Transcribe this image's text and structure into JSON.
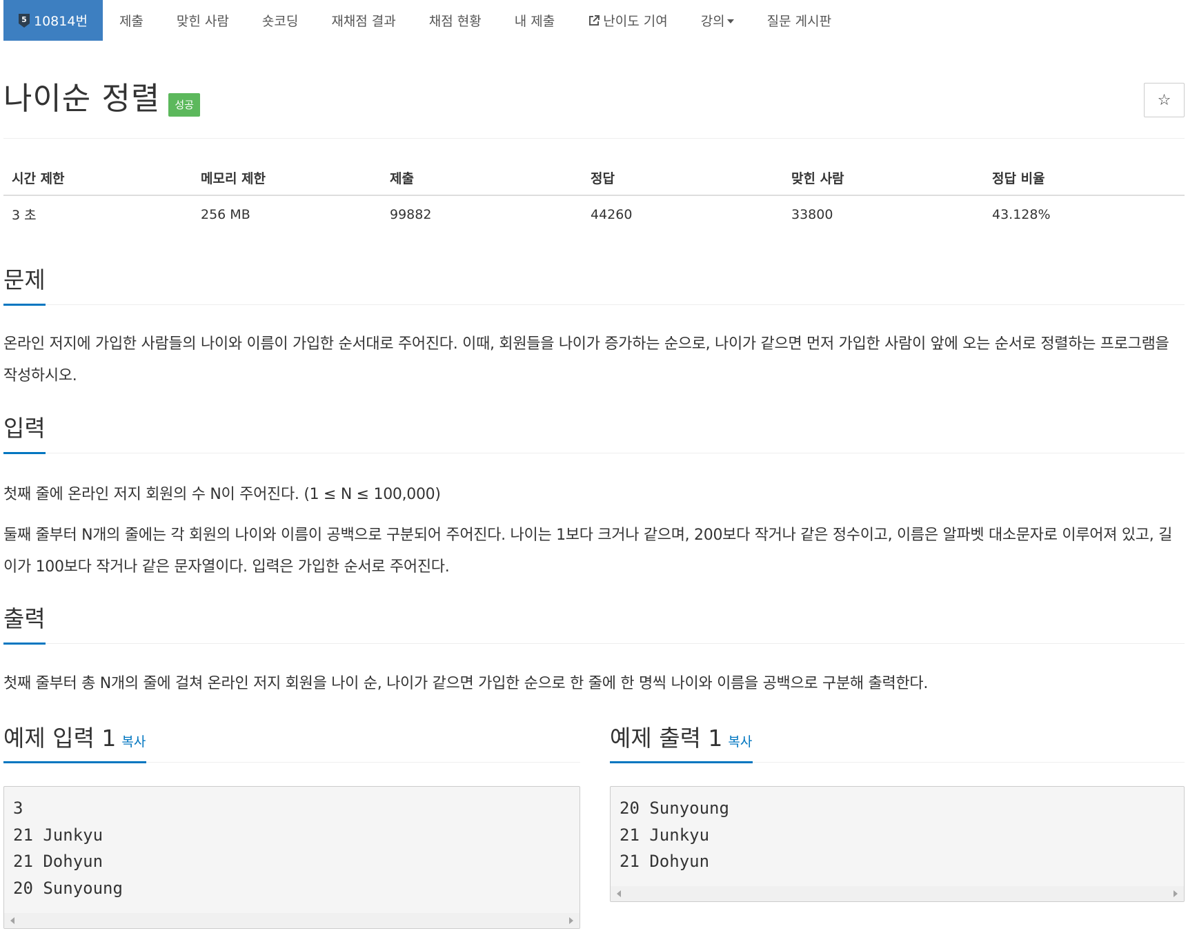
{
  "nav": {
    "tier_level": "5",
    "items": [
      {
        "label": "10814번"
      },
      {
        "label": "제출"
      },
      {
        "label": "맞힌 사람"
      },
      {
        "label": "숏코딩"
      },
      {
        "label": "재채점 결과"
      },
      {
        "label": "채점 현황"
      },
      {
        "label": "내 제출"
      },
      {
        "label": "난이도 기여"
      },
      {
        "label": "강의"
      },
      {
        "label": "질문 게시판"
      }
    ]
  },
  "problem": {
    "title": "나이순 정렬",
    "result_badge": "성공",
    "star_icon": "☆"
  },
  "stats": {
    "headers": [
      "시간 제한",
      "메모리 제한",
      "제출",
      "정답",
      "맞힌 사람",
      "정답 비율"
    ],
    "values": [
      "3 초",
      "256 MB",
      "99882",
      "44260",
      "33800",
      "43.128%"
    ]
  },
  "sections": {
    "problem_heading": "문제",
    "problem_text": "온라인 저지에 가입한 사람들의 나이와 이름이 가입한 순서대로 주어진다. 이때, 회원들을 나이가 증가하는 순으로, 나이가 같으면 먼저 가입한 사람이 앞에 오는 순서로 정렬하는 프로그램을 작성하시오.",
    "input_heading": "입력",
    "input_text_1": "첫째 줄에 온라인 저지 회원의 수 N이 주어진다. (1 ≤ N ≤ 100,000)",
    "input_text_2": "둘째 줄부터 N개의 줄에는 각 회원의 나이와 이름이 공백으로 구분되어 주어진다. 나이는 1보다 크거나 같으며, 200보다 작거나 같은 정수이고, 이름은 알파벳 대소문자로 이루어져 있고, 길이가 100보다 작거나 같은 문자열이다. 입력은 가입한 순서로 주어진다.",
    "output_heading": "출력",
    "output_text": "첫째 줄부터 총 N개의 줄에 걸쳐 온라인 저지 회원을 나이 순, 나이가 같으면 가입한 순으로 한 줄에 한 명씩 나이와 이름을 공백으로 구분해 출력한다."
  },
  "samples": {
    "input_heading": "예제 입력 1",
    "output_heading": "예제 출력 1",
    "copy_label": "복사",
    "input_text": "3\n21 Junkyu\n21 Dohyun\n20 Sunyoung",
    "output_text": "20 Sunyoung\n21 Junkyu\n21 Dohyun"
  },
  "colors": {
    "nav_active": "#3d7fc1",
    "success": "#5cb85c",
    "accent": "#0076c0"
  }
}
